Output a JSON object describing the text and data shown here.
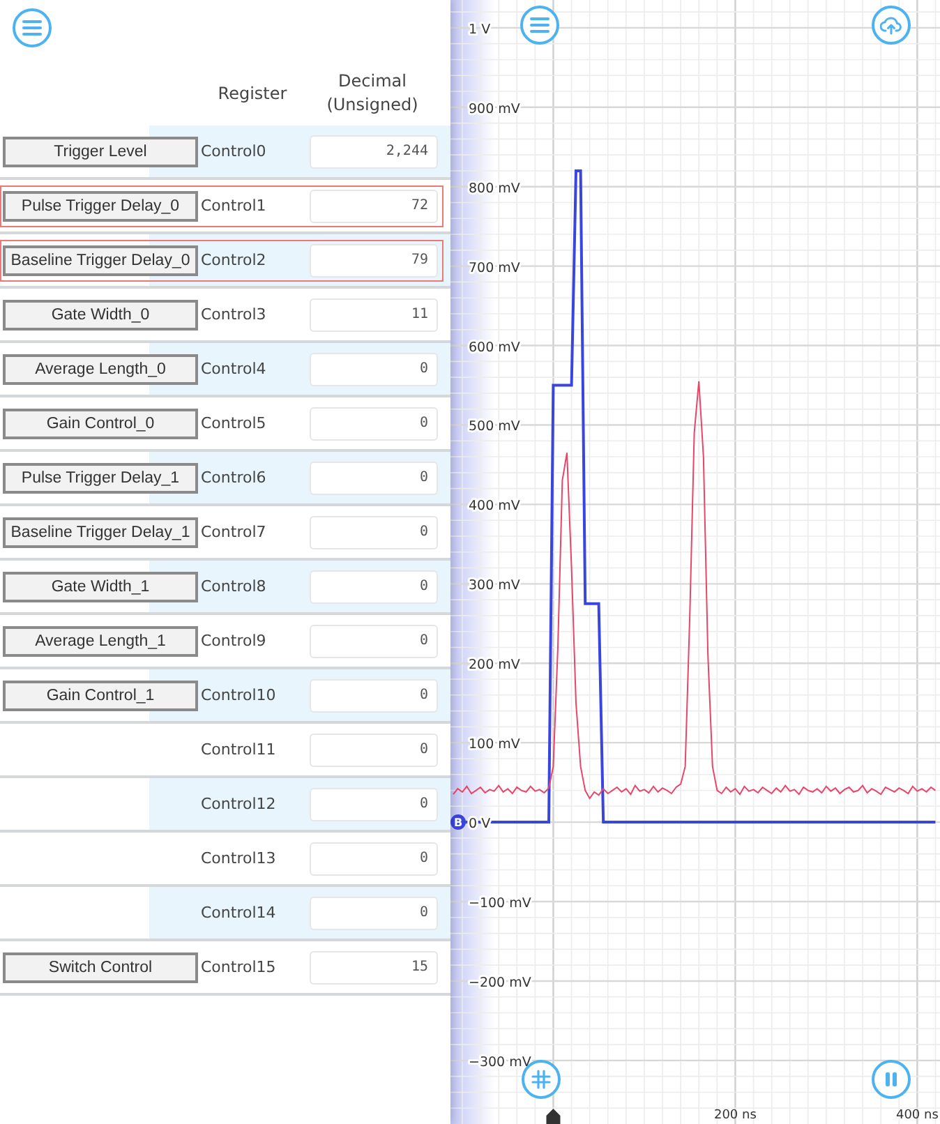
{
  "register_panel": {
    "columns": [
      "Register",
      "Decimal (Unsigned)"
    ],
    "rows": [
      {
        "button": "Trigger Level",
        "register": "Control0",
        "value": "2,244",
        "highlighted": false
      },
      {
        "button": "Pulse Trigger Delay_0",
        "register": "Control1",
        "value": "72",
        "highlighted": true
      },
      {
        "button": "Baseline Trigger Delay_0",
        "register": "Control2",
        "value": "79",
        "highlighted": true
      },
      {
        "button": "Gate Width_0",
        "register": "Control3",
        "value": "11",
        "highlighted": false
      },
      {
        "button": "Average Length_0",
        "register": "Control4",
        "value": "0",
        "highlighted": false
      },
      {
        "button": "Gain Control_0",
        "register": "Control5",
        "value": "0",
        "highlighted": false
      },
      {
        "button": "Pulse Trigger Delay_1",
        "register": "Control6",
        "value": "0",
        "highlighted": false
      },
      {
        "button": "Baseline Trigger Delay_1",
        "register": "Control7",
        "value": "0",
        "highlighted": false
      },
      {
        "button": "Gate Width_1",
        "register": "Control8",
        "value": "0",
        "highlighted": false
      },
      {
        "button": "Average Length_1",
        "register": "Control9",
        "value": "0",
        "highlighted": false
      },
      {
        "button": "Gain Control_1",
        "register": "Control10",
        "value": "0",
        "highlighted": false
      },
      {
        "register": "Control11",
        "value": "0",
        "highlighted": false
      },
      {
        "register": "Control12",
        "value": "0",
        "highlighted": false
      },
      {
        "register": "Control13",
        "value": "0",
        "highlighted": false
      },
      {
        "register": "Control14",
        "value": "0",
        "highlighted": false
      },
      {
        "button": "Switch Control",
        "register": "Control15",
        "value": "15",
        "highlighted": false
      }
    ]
  },
  "scope": {
    "top_tick_label": "1 V",
    "chart_data": {
      "type": "line",
      "grid": true,
      "xlim": [
        -113,
        425
      ],
      "ylim": [
        -380,
        1035
      ],
      "yticks": [
        {
          "value": 900,
          "label": "900 mV"
        },
        {
          "value": 800,
          "label": "800 mV"
        },
        {
          "value": 700,
          "label": "700 mV"
        },
        {
          "value": 600,
          "label": "600 mV"
        },
        {
          "value": 500,
          "label": "500 mV"
        },
        {
          "value": 400,
          "label": "400 mV"
        },
        {
          "value": 300,
          "label": "300 mV"
        },
        {
          "value": 200,
          "label": "200 mV"
        },
        {
          "value": 100,
          "label": "100 mV"
        },
        {
          "value": 0,
          "label": "0 V"
        },
        {
          "value": -100,
          "label": "−100 mV"
        },
        {
          "value": -200,
          "label": "−200 mV"
        },
        {
          "value": -300,
          "label": "−300 mV"
        }
      ],
      "xticks": [
        {
          "value": 200,
          "label": "200 ns"
        },
        {
          "value": 400,
          "label": "400 ns"
        }
      ],
      "x": [
        -110,
        -105,
        -100,
        -95,
        -90,
        -85,
        -80,
        -75,
        -70,
        -65,
        -60,
        -55,
        -50,
        -45,
        -40,
        -35,
        -30,
        -25,
        -20,
        -15,
        -10,
        -5,
        0,
        5,
        10,
        15,
        20,
        25,
        30,
        35,
        40,
        45,
        50,
        55,
        60,
        65,
        70,
        75,
        80,
        85,
        90,
        95,
        100,
        105,
        110,
        115,
        120,
        125,
        130,
        135,
        140,
        145,
        150,
        155,
        160,
        165,
        170,
        175,
        180,
        185,
        190,
        195,
        200,
        205,
        210,
        215,
        220,
        225,
        230,
        235,
        240,
        245,
        250,
        255,
        260,
        265,
        270,
        275,
        280,
        285,
        290,
        295,
        300,
        305,
        310,
        315,
        320,
        325,
        330,
        335,
        340,
        345,
        350,
        355,
        360,
        365,
        370,
        375,
        380,
        385,
        390,
        395,
        400,
        405,
        410,
        415,
        420
      ],
      "series": [
        {
          "name": "B",
          "color": "#3a45e0",
          "values": [
            0,
            0,
            0,
            0,
            0,
            0,
            0,
            0,
            0,
            0,
            0,
            0,
            0,
            0,
            0,
            0,
            0,
            0,
            0,
            0,
            0,
            0,
            550,
            550,
            550,
            550,
            550,
            820,
            820,
            275,
            275,
            275,
            275,
            0,
            0,
            0,
            0,
            0,
            0,
            0,
            0,
            0,
            0,
            0,
            0,
            0,
            0,
            0,
            0,
            0,
            0,
            0,
            0,
            0,
            0,
            0,
            0,
            0,
            0,
            0,
            0,
            0,
            0,
            0,
            0,
            0,
            0,
            0,
            0,
            0,
            0,
            0,
            0,
            0,
            0,
            0,
            0,
            0,
            0,
            0,
            0,
            0,
            0,
            0,
            0,
            0,
            0,
            0,
            0,
            0,
            0,
            0,
            0,
            0,
            0,
            0,
            0,
            0,
            0,
            0,
            0,
            0,
            0,
            0,
            0,
            0,
            0
          ]
        },
        {
          "color": "#e8456a",
          "values": [
            35,
            42,
            38,
            45,
            36,
            40,
            44,
            37,
            41,
            39,
            46,
            38,
            42,
            36,
            44,
            40,
            38,
            45,
            39,
            41,
            37,
            43,
            70,
            220,
            430,
            465,
            320,
            150,
            70,
            40,
            30,
            38,
            34,
            42,
            36,
            40,
            44,
            38,
            42,
            35,
            46,
            39,
            41,
            37,
            45,
            38,
            43,
            40,
            36,
            44,
            48,
            70,
            260,
            490,
            555,
            460,
            210,
            70,
            40,
            36,
            44,
            38,
            42,
            35,
            45,
            39,
            41,
            37,
            44,
            40,
            36,
            43,
            38,
            46,
            39,
            41,
            35,
            44,
            40,
            38,
            42,
            37,
            45,
            39,
            43,
            36,
            41,
            44,
            38,
            40,
            46,
            37,
            42,
            39,
            35,
            44,
            41,
            38,
            43,
            40,
            36,
            45,
            39,
            42,
            38,
            44,
            40
          ]
        }
      ]
    }
  }
}
